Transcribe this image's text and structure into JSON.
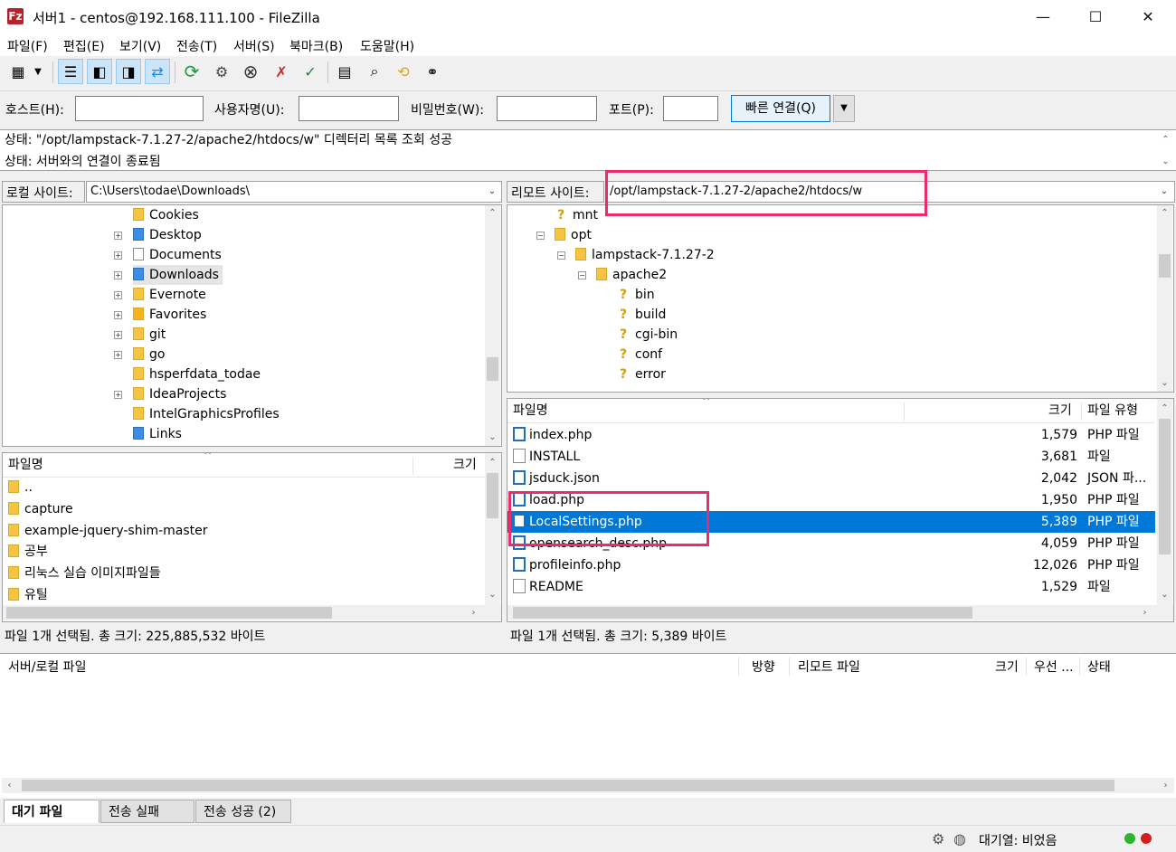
{
  "window": {
    "title": "서버1 - centos@192.168.111.100 - FileZilla",
    "app_icon": "Fz",
    "controls": {
      "minimize": "—",
      "maximize": "☐",
      "close": "✕"
    }
  },
  "menu": [
    "파일(F)",
    "편집(E)",
    "보기(V)",
    "전송(T)",
    "서버(S)",
    "북마크(B)",
    "도움말(H)"
  ],
  "quickconnect": {
    "host_label": "호스트(H):",
    "user_label": "사용자명(U):",
    "pass_label": "비밀번호(W):",
    "port_label": "포트(P):",
    "host_value": "",
    "user_value": "",
    "pass_value": "",
    "port_value": "",
    "button_label": "빠른 연결(Q)",
    "dropdown_icon": "▼"
  },
  "log": [
    "상태:  \"/opt/lampstack-7.1.27-2/apache2/htdocs/w\" 디렉터리 목록 조회 성공",
    "상태:  서버와의 연결이 종료됨"
  ],
  "local": {
    "site_label": "로컬 사이트:",
    "path": "C:\\Users\\todae\\Downloads\\",
    "tree": [
      {
        "name": "Cookies",
        "expander": false,
        "icon": "folder"
      },
      {
        "name": "Desktop",
        "expander": true,
        "icon": "desktop-folder"
      },
      {
        "name": "Documents",
        "expander": true,
        "icon": "documents-folder"
      },
      {
        "name": "Downloads",
        "expander": true,
        "icon": "downloads-folder",
        "selected": true
      },
      {
        "name": "Evernote",
        "expander": true,
        "icon": "folder"
      },
      {
        "name": "Favorites",
        "expander": true,
        "icon": "favorites-folder"
      },
      {
        "name": "git",
        "expander": true,
        "icon": "folder"
      },
      {
        "name": "go",
        "expander": true,
        "icon": "folder"
      },
      {
        "name": "hsperfdata_todae",
        "expander": false,
        "icon": "folder"
      },
      {
        "name": "IdeaProjects",
        "expander": true,
        "icon": "folder"
      },
      {
        "name": "IntelGraphicsProfiles",
        "expander": false,
        "icon": "folder"
      },
      {
        "name": "Links",
        "expander": false,
        "icon": "links-folder"
      }
    ],
    "columns": {
      "name": "파일명",
      "size": "크기"
    },
    "files": [
      "..",
      "capture",
      "example-jquery-shim-master",
      "공부",
      "리눅스 실습 이미지파일들",
      "유틸"
    ],
    "status": "파일 1개 선택됨. 총 크기: 225,885,532 바이트"
  },
  "remote": {
    "site_label": "리모트 사이트:",
    "path": "/opt/lampstack-7.1.27-2/apache2/htdocs/w",
    "tree": [
      {
        "name": "mnt",
        "depth": 0,
        "icon": "unknown"
      },
      {
        "name": "opt",
        "depth": 0,
        "icon": "folder",
        "expanded": true
      },
      {
        "name": "lampstack-7.1.27-2",
        "depth": 1,
        "icon": "folder",
        "expanded": true
      },
      {
        "name": "apache2",
        "depth": 2,
        "icon": "folder",
        "expanded": true
      },
      {
        "name": "bin",
        "depth": 3,
        "icon": "unknown"
      },
      {
        "name": "build",
        "depth": 3,
        "icon": "unknown"
      },
      {
        "name": "cgi-bin",
        "depth": 3,
        "icon": "unknown"
      },
      {
        "name": "conf",
        "depth": 3,
        "icon": "unknown"
      },
      {
        "name": "error",
        "depth": 3,
        "icon": "unknown"
      }
    ],
    "columns": {
      "name": "파일명",
      "size": "크기",
      "type": "파일 유형"
    },
    "files": [
      {
        "name": "index.php",
        "size": "1,579",
        "type": "PHP 파일",
        "icon": "php"
      },
      {
        "name": "INSTALL",
        "size": "3,681",
        "type": "파일",
        "icon": "doc"
      },
      {
        "name": "jsduck.json",
        "size": "2,042",
        "type": "JSON 파...",
        "icon": "php"
      },
      {
        "name": "load.php",
        "size": "1,950",
        "type": "PHP 파일",
        "icon": "php"
      },
      {
        "name": "LocalSettings.php",
        "size": "5,389",
        "type": "PHP 파일",
        "icon": "php",
        "selected": true
      },
      {
        "name": "opensearch_desc.php",
        "size": "4,059",
        "type": "PHP 파일",
        "icon": "php"
      },
      {
        "name": "profileinfo.php",
        "size": "12,026",
        "type": "PHP 파일",
        "icon": "php"
      },
      {
        "name": "README",
        "size": "1,529",
        "type": "파일",
        "icon": "doc"
      }
    ],
    "status": "파일 1개 선택됨. 총 크기: 5,389 바이트"
  },
  "queue": {
    "columns": {
      "file": "서버/로컬 파일",
      "direction": "방향",
      "remote": "리모트 파일",
      "size": "크기",
      "priority": "우선 ...",
      "status": "상태"
    },
    "tabs": [
      "대기 파일",
      "전송 실패",
      "전송 성공 (2)"
    ]
  },
  "statusbar": {
    "queue_text": "대기열: 비었음"
  },
  "colors": {
    "selection": "#0078d7",
    "annotation": "#ee2a6e",
    "led_green": "#2db52d",
    "led_red": "#d21f1f"
  }
}
